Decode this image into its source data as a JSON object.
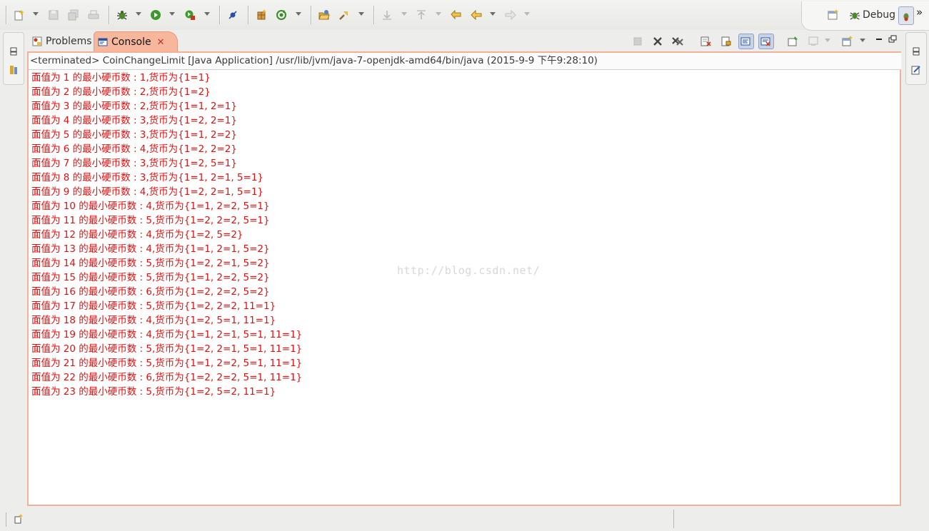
{
  "toolbar": {
    "icons": [
      "new-icon",
      "save-icon",
      "save-all-icon",
      "print-icon",
      "debug-icon",
      "run-icon",
      "external-tools-icon",
      "skip-breakpoints-icon",
      "new-java-package-icon",
      "refresh-icon",
      "open-type-icon",
      "search-icon",
      "next-annotation-icon",
      "previous-annotation-icon",
      "last-edit-icon",
      "back-icon",
      "forward-icon"
    ]
  },
  "perspective": {
    "open_perspective_icon": "open-perspective-icon",
    "debug_label": "Debug",
    "java_icon": "java-perspective-icon",
    "overflow": "»"
  },
  "console_view": {
    "tabs": [
      {
        "label": "Problems",
        "icon": "problems-icon",
        "active": false
      },
      {
        "label": "Console",
        "icon": "console-icon",
        "active": true,
        "close": "✕"
      }
    ],
    "toolbar_icons": [
      "terminate-icon",
      "remove-launch-icon",
      "remove-all-terminated-icon",
      "clear-console-icon",
      "scroll-lock-icon",
      "word-wrap-icon",
      "show-when-stdout-icon",
      "show-when-stderr-icon",
      "pin-console-icon",
      "display-selected-console-icon",
      "open-console-icon",
      "minimize-icon",
      "maximize-icon"
    ],
    "status_line": "<terminated> CoinChangeLimit [Java Application] /usr/lib/jvm/java-7-openjdk-amd64/bin/java (2015-9-9 下午9:28:10)",
    "output": [
      "面值为 1 的最小硬币数 : 1,货币为{1=1}",
      "面值为 2 的最小硬币数 : 2,货币为{1=2}",
      "面值为 3 的最小硬币数 : 2,货币为{1=1, 2=1}",
      "面值为 4 的最小硬币数 : 3,货币为{1=2, 2=1}",
      "面值为 5 的最小硬币数 : 3,货币为{1=1, 2=2}",
      "面值为 6 的最小硬币数 : 4,货币为{1=2, 2=2}",
      "面值为 7 的最小硬币数 : 3,货币为{1=2, 5=1}",
      "面值为 8 的最小硬币数 : 3,货币为{1=1, 2=1, 5=1}",
      "面值为 9 的最小硬币数 : 4,货币为{1=2, 2=1, 5=1}",
      "面值为 10 的最小硬币数 : 4,货币为{1=1, 2=2, 5=1}",
      "面值为 11 的最小硬币数 : 5,货币为{1=2, 2=2, 5=1}",
      "面值为 12 的最小硬币数 : 4,货币为{1=2, 5=2}",
      "面值为 13 的最小硬币数 : 4,货币为{1=1, 2=1, 5=2}",
      "面值为 14 的最小硬币数 : 5,货币为{1=2, 2=1, 5=2}",
      "面值为 15 的最小硬币数 : 5,货币为{1=1, 2=2, 5=2}",
      "面值为 16 的最小硬币数 : 6,货币为{1=2, 2=2, 5=2}",
      "面值为 17 的最小硬币数 : 5,货币为{1=2, 2=2, 11=1}",
      "面值为 18 的最小硬币数 : 4,货币为{1=2, 5=1, 11=1}",
      "面值为 19 的最小硬币数 : 4,货币为{1=1, 2=1, 5=1, 11=1}",
      "面值为 20 的最小硬币数 : 5,货币为{1=2, 2=1, 5=1, 11=1}",
      "面值为 21 的最小硬币数 : 5,货币为{1=1, 2=2, 5=1, 11=1}",
      "面值为 22 的最小硬币数 : 6,货币为{1=2, 2=2, 5=1, 11=1}",
      "面值为 23 的最小硬币数 : 5,货币为{1=2, 5=2, 11=1}"
    ],
    "watermark": "http://blog.csdn.net/",
    "output_color": "#e01010",
    "active_tab_color": "#f6b79c"
  }
}
